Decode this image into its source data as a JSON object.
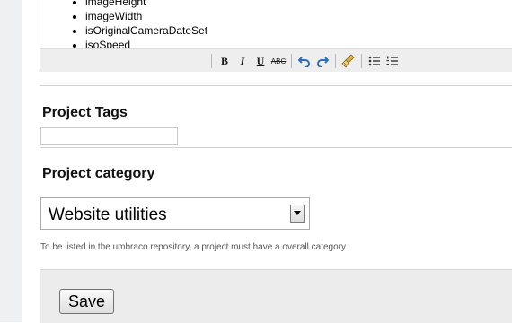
{
  "editor": {
    "list_items": [
      "imageHeight",
      "imageWidth",
      "isOriginalCameraDateSet",
      "isoSpeed"
    ],
    "toolbar": {
      "bold": "B",
      "italic": "I",
      "underline": "U",
      "strikethrough": "ABC"
    }
  },
  "tags": {
    "label": "Project Tags",
    "value": ""
  },
  "category": {
    "label": "Project category",
    "selected": "Website utilities",
    "help": "To be listed in the umbraco repository, a project must have a overall category"
  },
  "footer": {
    "save_label": "Save"
  },
  "colors": {
    "undo_blue": "#2e6fb8",
    "toolbar_bg": "#eeeeee",
    "footer_bg": "#ececec"
  }
}
